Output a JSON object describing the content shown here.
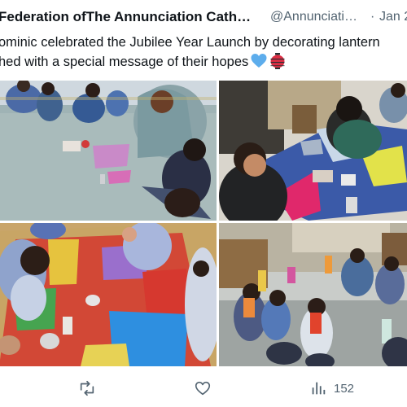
{
  "tweet": {
    "author_name": "Federation ofThe Annunciation Cath…",
    "author_handle": "@Annunciati…",
    "separator": "·",
    "date": "Jan 2",
    "text_line_1": "ominic celebrated the Jubilee Year Launch by decorating lantern",
    "text_line_2": "hed with a special message of their hopes",
    "emojis": [
      "blue-heart",
      "red-lantern"
    ]
  },
  "media": {
    "photos": [
      {
        "name": "children-decorating-on-floor"
      },
      {
        "name": "children-at-table-with-paper"
      },
      {
        "name": "children-on-red-mat"
      },
      {
        "name": "children-holding-lanterns"
      }
    ]
  },
  "actions": {
    "retweet_icon": "retweet-icon",
    "like_icon": "heart-icon",
    "views_icon": "views-icon",
    "views_count": "152"
  },
  "colors": {
    "text": "#0f1419",
    "secondary": "#536471",
    "heart_emoji": "#5dadec",
    "lantern_emoji": "#dd2e44"
  }
}
